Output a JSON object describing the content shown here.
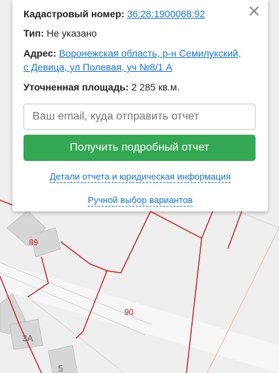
{
  "popup": {
    "cadastral_label": "Кадастровый номер:",
    "cadastral_value": "36:28:1900068:92",
    "type_label": "Тип:",
    "type_value": "Не указано",
    "address_label": "Адрес:",
    "address_value": "Воронежская область, р-н Семилукский, с Девица, ул Полевая, уч №8/1 А",
    "area_label": "Уточненная площадь:",
    "area_value": "2 285 кв.м.",
    "email_placeholder": "Ваш email, куда отправить отчет",
    "submit_label": "Получить подробный отчет",
    "details_link": "Детали отчета и юридическая информация",
    "manual_link": "Ручной выбор вариантов"
  },
  "map": {
    "labels": {
      "parcel_89": "89",
      "parcel_90": "90",
      "house_3a": "3А",
      "house_5": "5"
    }
  },
  "colors": {
    "accent_button": "#34a853",
    "link": "#1a73c8",
    "parcel_border": "#c62828"
  }
}
